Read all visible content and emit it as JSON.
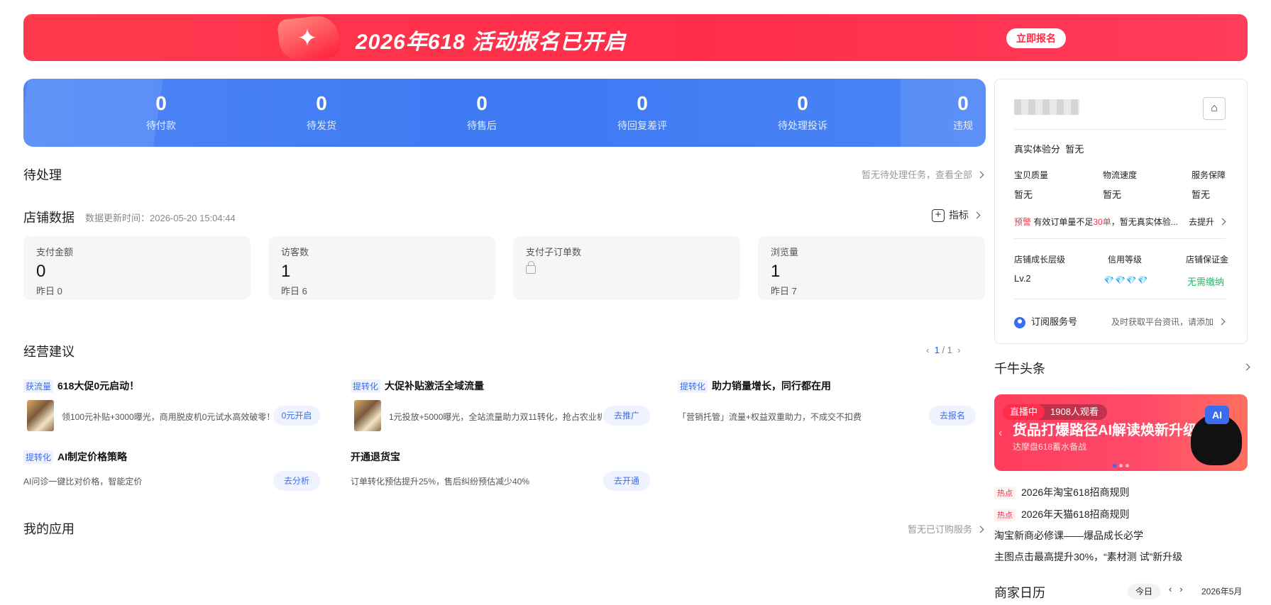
{
  "banner": {
    "title": "2026年618 活动报名已开启",
    "button": "立即报名",
    "color": "#ff2d4a"
  },
  "stats": [
    {
      "value": "0",
      "label": "待付款"
    },
    {
      "value": "0",
      "label": "待发货"
    },
    {
      "value": "0",
      "label": "待售后"
    },
    {
      "value": "0",
      "label": "待回复差评"
    },
    {
      "value": "0",
      "label": "待处理投诉"
    },
    {
      "value": "0",
      "label": "违规"
    }
  ],
  "pending": {
    "title": "待处理",
    "link": "暂无待处理任务，查看全部"
  },
  "shop_data": {
    "title": "店铺数据",
    "update_time": "数据更新时间：2026-05-20 15:04:44",
    "metric_button": "指标",
    "cards": [
      {
        "label": "支付金额",
        "value": "0",
        "sub": "昨日 0"
      },
      {
        "label": "访客数",
        "value": "1",
        "sub": "昨日 6"
      },
      {
        "label": "支付子订单数",
        "value": "",
        "sub": ""
      },
      {
        "label": "浏览量",
        "value": "1",
        "sub": "昨日 7"
      }
    ]
  },
  "advice": {
    "title": "经营建议",
    "pager_current": "1",
    "pager_total": "/ 1",
    "items": [
      {
        "tag": "获流量",
        "title": "618大促0元启动！",
        "desc": "领100元补贴+3000曝光，商用脱皮机0元试水高效破零！",
        "button": "0元开启"
      },
      {
        "tag": "提转化",
        "title": "大促补贴激活全域流量",
        "desc": "1元投放+5000曝光，全站流量助力双11转化，抢占农业机",
        "button": "去推广"
      },
      {
        "tag": "提转化",
        "title": "助力销量增长，同行都在用",
        "desc": "「营销托管」流量+权益双重助力，不成交不扣费",
        "button": "去报名"
      },
      {
        "tag": "提转化",
        "title": "AI制定价格策略",
        "desc": "AI问诊一键比对价格，智能定价",
        "button": "去分析"
      },
      {
        "tag": "",
        "title": "开通退货宝",
        "desc": "订单转化预估提升25%，售后纠纷预估减少40%",
        "button": "去开通"
      }
    ]
  },
  "apps": {
    "title": "我的应用",
    "link": "暂无已订购服务"
  },
  "shop_panel": {
    "experience_label": "真实体验分",
    "experience_value": "暂无",
    "scores": [
      {
        "label": "宝贝质量",
        "value": "暂无"
      },
      {
        "label": "物流速度",
        "value": "暂无"
      },
      {
        "label": "服务保障",
        "value": "暂无"
      }
    ],
    "warning_tag": "预警",
    "warning_text_1": "有效订单量不足",
    "warning_count": "30单",
    "warning_text_2": "，暂无真实体验...",
    "warning_link": "去提升",
    "growth_label": "店铺成长层级",
    "growth_value": "Lv.2",
    "credit_label": "信用等级",
    "credit_value": "💎💎💎💎",
    "deposit_label": "店铺保证金",
    "deposit_value": "无需缴纳",
    "subscribe_label": "订阅服务号",
    "subscribe_desc": "及时获取平台资讯，请添加"
  },
  "headlines": {
    "title": "千牛头条",
    "live_badge": "直播中",
    "live_viewers": "1908人观看",
    "live_title": "货品打爆路径AI解读焕新升级",
    "live_sub": "达摩盘618蓄水备战",
    "news": [
      {
        "hot": "热点",
        "text": "2026年淘宝618招商规则"
      },
      {
        "hot": "热点",
        "text": "2026年天猫618招商规则"
      },
      {
        "hot": "",
        "text": "淘宝新商必修课——爆品成长必学"
      },
      {
        "hot": "",
        "text": "主图点击最高提升30%，“素材测 试”新升级"
      }
    ]
  },
  "calendar": {
    "title": "商家日历",
    "today": "今日",
    "month": "2026年5月"
  },
  "colors": {
    "primary_blue": "#3d79f2",
    "accent_red": "#ff2d4a",
    "green": "#26b36b"
  }
}
